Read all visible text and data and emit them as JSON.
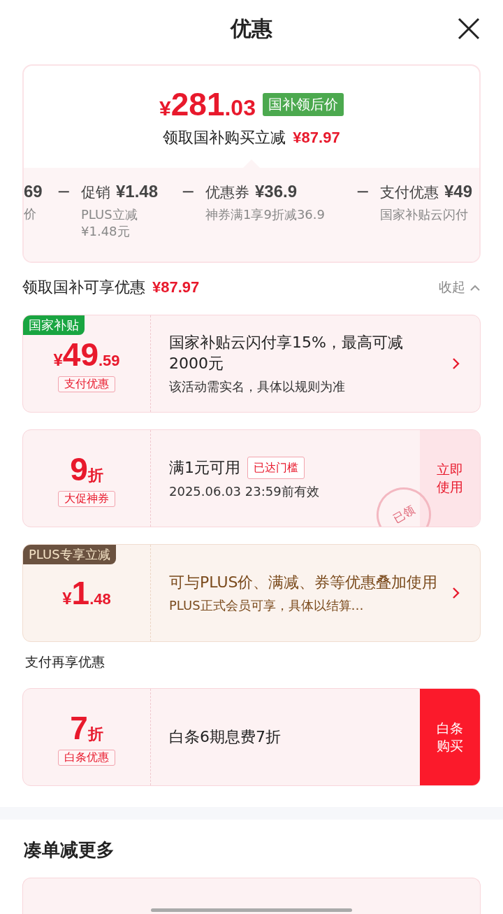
{
  "header": {
    "title": "优惠"
  },
  "summary": {
    "price_currency": "¥",
    "price_main": "281",
    "price_decimal": ".03",
    "price_tag": "国补领后价",
    "subtitle": "领取国补购买立减",
    "subtitle_amount": "¥87.97",
    "breakdown": [
      {
        "amount": "69",
        "note": "价"
      },
      {
        "operator": "−",
        "label": "促销",
        "amount": "¥1.48",
        "note": "PLUS立减¥1.48元"
      },
      {
        "operator": "−",
        "label": "优惠券",
        "amount": "¥36.9",
        "note": "神券满1享9折减36.9"
      },
      {
        "operator": "−",
        "label": "支付优惠",
        "amount": "¥49",
        "note": "国家补贴云闪付"
      }
    ]
  },
  "section": {
    "title": "领取国补可享优惠",
    "amount": "¥87.97",
    "toggle": "收起",
    "expanded": true
  },
  "coupons": [
    {
      "kind": "subsidy",
      "tag": "国家补贴",
      "prefix": "¥",
      "main": "49",
      "suffix": ".59",
      "badge": "支付优惠",
      "title": "国家补贴云闪付享15%，最高可减2000元",
      "subtitle": "该活动需实名，具体以规则为准",
      "action": {
        "kind": "arrow"
      }
    },
    {
      "kind": "coupon",
      "main": "9",
      "suffix": "折",
      "badge": "大促神券",
      "title": "满1元可用",
      "condition": "已达门槛",
      "subtitle": "2025.06.03 23:59前有效",
      "stamp": "已领",
      "action": {
        "kind": "use",
        "label": "立即使用"
      }
    },
    {
      "kind": "plus",
      "tag": "PLUS专享立减",
      "prefix": "¥",
      "main": "1",
      "suffix": ".48",
      "title": "可与PLUS价、满减、券等优惠叠加使用",
      "subtitle": "PLUS正式会员可享，具体以结算…",
      "action": {
        "kind": "arrow"
      }
    }
  ],
  "pay_section": {
    "title": "支付再享优惠"
  },
  "pay_coupons": [
    {
      "kind": "coupon",
      "main": "7",
      "suffix": "折",
      "badge": "白条优惠",
      "title": "白条6期息费7折",
      "action": {
        "kind": "buy",
        "label": "白条购买"
      }
    }
  ],
  "more_section": {
    "title": "凑单减更多"
  }
}
